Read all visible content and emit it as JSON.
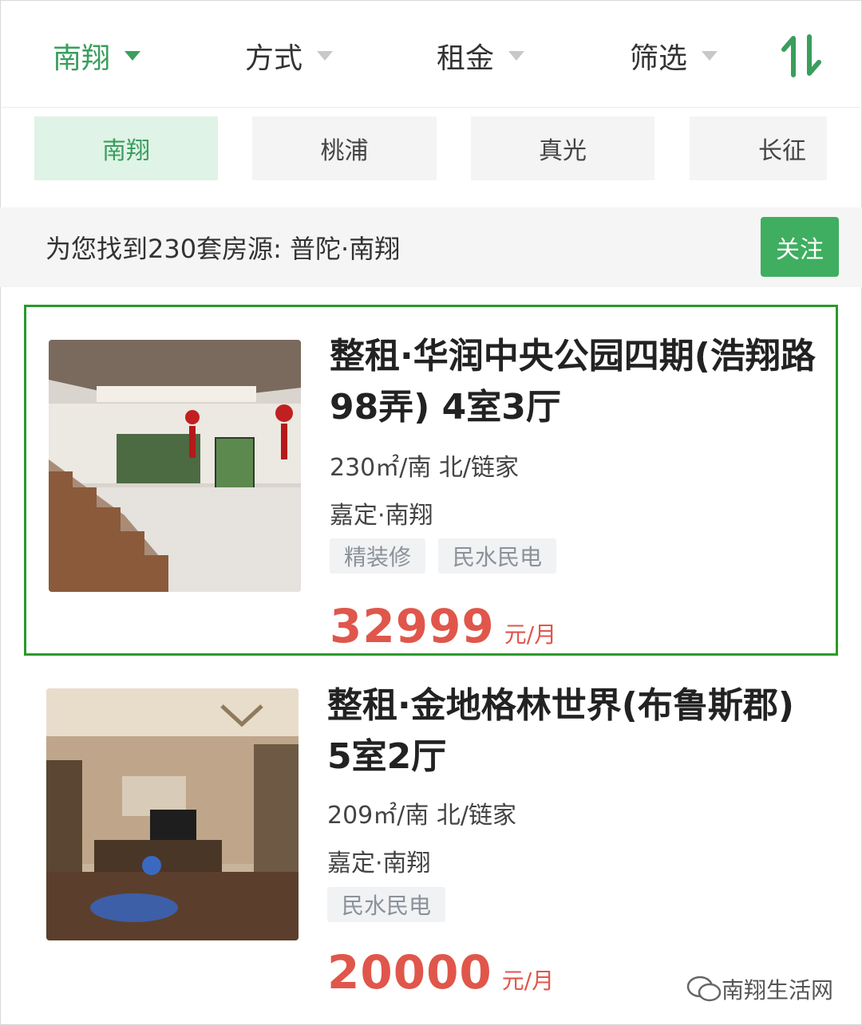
{
  "filters": [
    {
      "label": "南翔",
      "active": true
    },
    {
      "label": "方式",
      "active": false
    },
    {
      "label": "租金",
      "active": false
    },
    {
      "label": "筛选",
      "active": false
    }
  ],
  "sort_icon": "sort-arrows-icon",
  "area_tags": [
    "南翔",
    "桃浦",
    "真光",
    "长征"
  ],
  "result": {
    "text": "为您找到230套房源: 普陀·南翔",
    "follow_label": "关注"
  },
  "listings": [
    {
      "title": "整租·华润中央公园四期(浩翔路98弄) 4室3厅",
      "spec": "230㎡/南 北/链家",
      "location": "嘉定·南翔",
      "features": [
        "精装修",
        "民水民电"
      ],
      "price": "32999",
      "unit": "元/月"
    },
    {
      "title": "整租·金地格林世界(布鲁斯郡) 5室2厅",
      "spec": "209㎡/南 北/链家",
      "location": "嘉定·南翔",
      "features": [
        "民水民电"
      ],
      "price": "20000",
      "unit": "元/月"
    }
  ],
  "watermark": "南翔生活网",
  "colors": {
    "accent": "#3a9e5d",
    "price": "#e0564b",
    "selected_border": "#2a9a2a"
  }
}
